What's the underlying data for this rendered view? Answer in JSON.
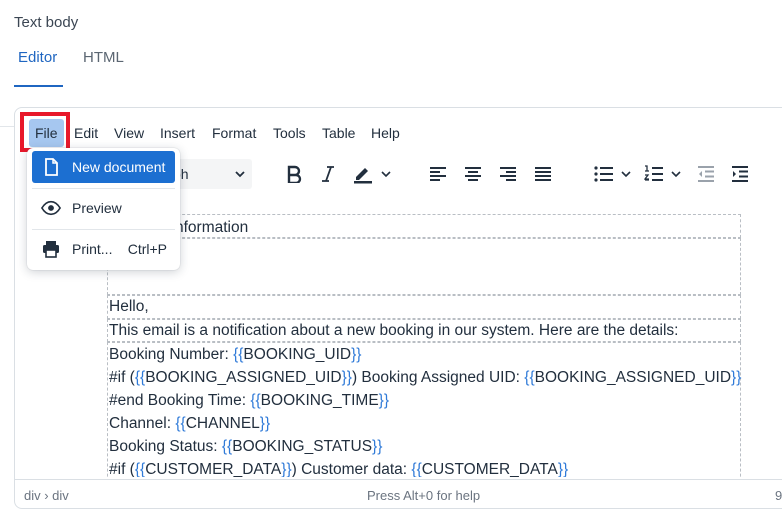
{
  "field": {
    "label": "Text body"
  },
  "tabs": [
    {
      "label": "Editor",
      "active": true
    },
    {
      "label": "HTML",
      "active": false
    }
  ],
  "menubar": [
    "File",
    "Edit",
    "View",
    "Insert",
    "Format",
    "Tools",
    "Table",
    "Help"
  ],
  "toolbar": {
    "block_format": "Paragraph",
    "block_format_visible": "ph",
    "buttons": [
      "bold-icon",
      "italic-icon",
      "highlight-icon",
      "align-left-icon",
      "align-center-icon",
      "align-right-icon",
      "justify-icon",
      "bullet-list-icon",
      "numbered-list-icon",
      "outdent-icon",
      "indent-icon"
    ]
  },
  "file_menu": {
    "items": [
      {
        "icon": "new-document-icon",
        "label": "New document",
        "shortcut": ""
      },
      {
        "icon": "preview-eye-icon",
        "label": "Preview",
        "shortcut": ""
      },
      {
        "icon": "print-icon",
        "label": "Print...",
        "shortcut": "Ctrl+P"
      }
    ]
  },
  "content": {
    "heading_partial": "nformation",
    "greeting": "Hello,",
    "intro": "This email is a notification about a new booking in our system. Here are the details:",
    "lines": [
      {
        "pre": "Booking Number: ",
        "open": "{{",
        "var": "BOOKING_UID",
        "close": "}}",
        "post": ""
      },
      {
        "pre": "#if (",
        "open": "{{",
        "var": "BOOKING_ASSIGNED_UID",
        "close": "}}",
        "post": ") Booking Assigned UID: ",
        "open2": "{{",
        "var2": "BOOKING_ASSIGNED_UID",
        "close2": "}}"
      },
      {
        "pre": "#end Booking Time: ",
        "open": "{{",
        "var": "BOOKING_TIME",
        "close": "}}",
        "post": ""
      },
      {
        "pre": "Channel: ",
        "open": "{{",
        "var": "CHANNEL",
        "close": "}}",
        "post": ""
      },
      {
        "pre": "Booking Status: ",
        "open": "{{",
        "var": "BOOKING_STATUS",
        "close": "}}",
        "post": ""
      },
      {
        "pre": "#if (",
        "open": "{{",
        "var": "CUSTOMER_DATA",
        "close": "}}",
        "post": ") Customer data: ",
        "open2": "{{",
        "var2": "CUSTOMER_DATA",
        "close2": "}}"
      }
    ]
  },
  "statusbar": {
    "path": "div › div",
    "help": "Press Alt+0 for help",
    "right": "9"
  },
  "colors": {
    "accent": "#1f66c1",
    "menu_hover": "#1c6fd1",
    "highlight_border": "#e8182a",
    "template_brace": "#2f7ad8"
  }
}
